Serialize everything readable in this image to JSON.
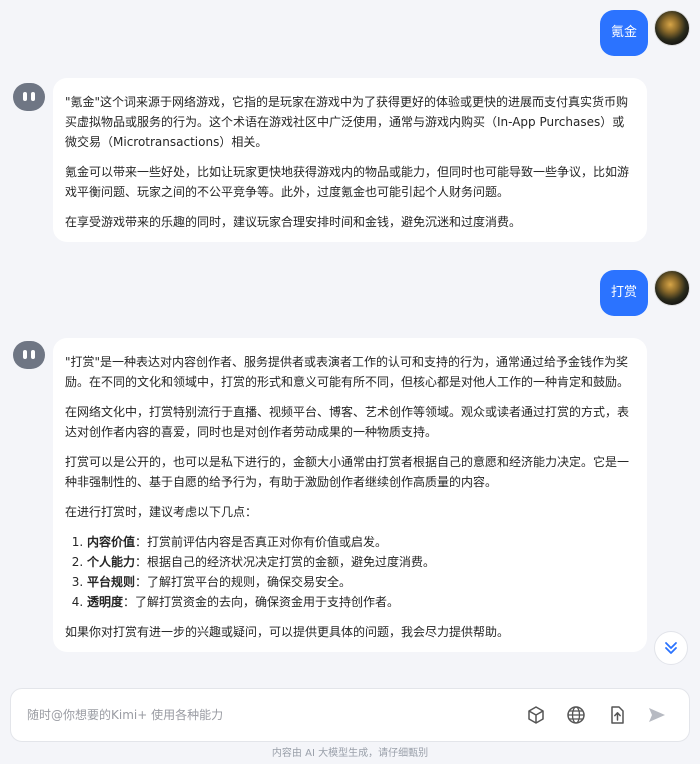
{
  "conversation": {
    "user_1": {
      "text": "氪金"
    },
    "bot_1": {
      "paragraphs": [
        "\"氪金\"这个词来源于网络游戏，它指的是玩家在游戏中为了获得更好的体验或更快的进展而支付真实货币购买虚拟物品或服务的行为。这个术语在游戏社区中广泛使用，通常与游戏内购买（In-App Purchases）或微交易（Microtransactions）相关。",
        "氪金可以带来一些好处，比如让玩家更快地获得游戏内的物品或能力，但同时也可能导致一些争议，比如游戏平衡问题、玩家之间的不公平竞争等。此外，过度氪金也可能引起个人财务问题。",
        "在享受游戏带来的乐趣的同时，建议玩家合理安排时间和金钱，避免沉迷和过度消费。"
      ]
    },
    "user_2": {
      "text": "打赏"
    },
    "bot_2": {
      "paragraphs": [
        "\"打赏\"是一种表达对内容创作者、服务提供者或表演者工作的认可和支持的行为，通常通过给予金钱作为奖励。在不同的文化和领域中，打赏的形式和意义可能有所不同，但核心都是对他人工作的一种肯定和鼓励。",
        "在网络文化中，打赏特别流行于直播、视频平台、博客、艺术创作等领域。观众或读者通过打赏的方式，表达对创作者内容的喜爱，同时也是对创作者劳动成果的一种物质支持。",
        "打赏可以是公开的，也可以是私下进行的，金额大小通常由打赏者根据自己的意愿和经济能力决定。它是一种非强制性的、基于自愿的给予行为，有助于激励创作者继续创作高质量的内容。",
        "在进行打赏时，建议考虑以下几点："
      ],
      "list": [
        {
          "term": "内容价值",
          "desc": "：打赏前评估内容是否真正对你有价值或启发。"
        },
        {
          "term": "个人能力",
          "desc": "：根据自己的经济状况决定打赏的金额，避免过度消费。"
        },
        {
          "term": "平台规则",
          "desc": "：了解打赏平台的规则，确保交易安全。"
        },
        {
          "term": "透明度",
          "desc": "：了解打赏资金的去向，确保资金用于支持创作者。"
        }
      ],
      "closing": "如果你对打赏有进一步的兴趣或疑问，可以提供更具体的问题，我会尽力提供帮助。"
    }
  },
  "input": {
    "placeholder": "随时@你想要的Kimi+ 使用各种能力"
  },
  "icons": {
    "scroll_down": "double-chevron-down-icon",
    "cube": "cube-icon",
    "globe": "globe-icon",
    "upload": "upload-file-icon",
    "send": "send-icon"
  },
  "footer": {
    "note": "内容由 AI 大模型生成，请仔细甄别"
  },
  "colors": {
    "accent": "#2b73ff",
    "background": "#f4f5f9",
    "bot_avatar": "#6f7684"
  }
}
